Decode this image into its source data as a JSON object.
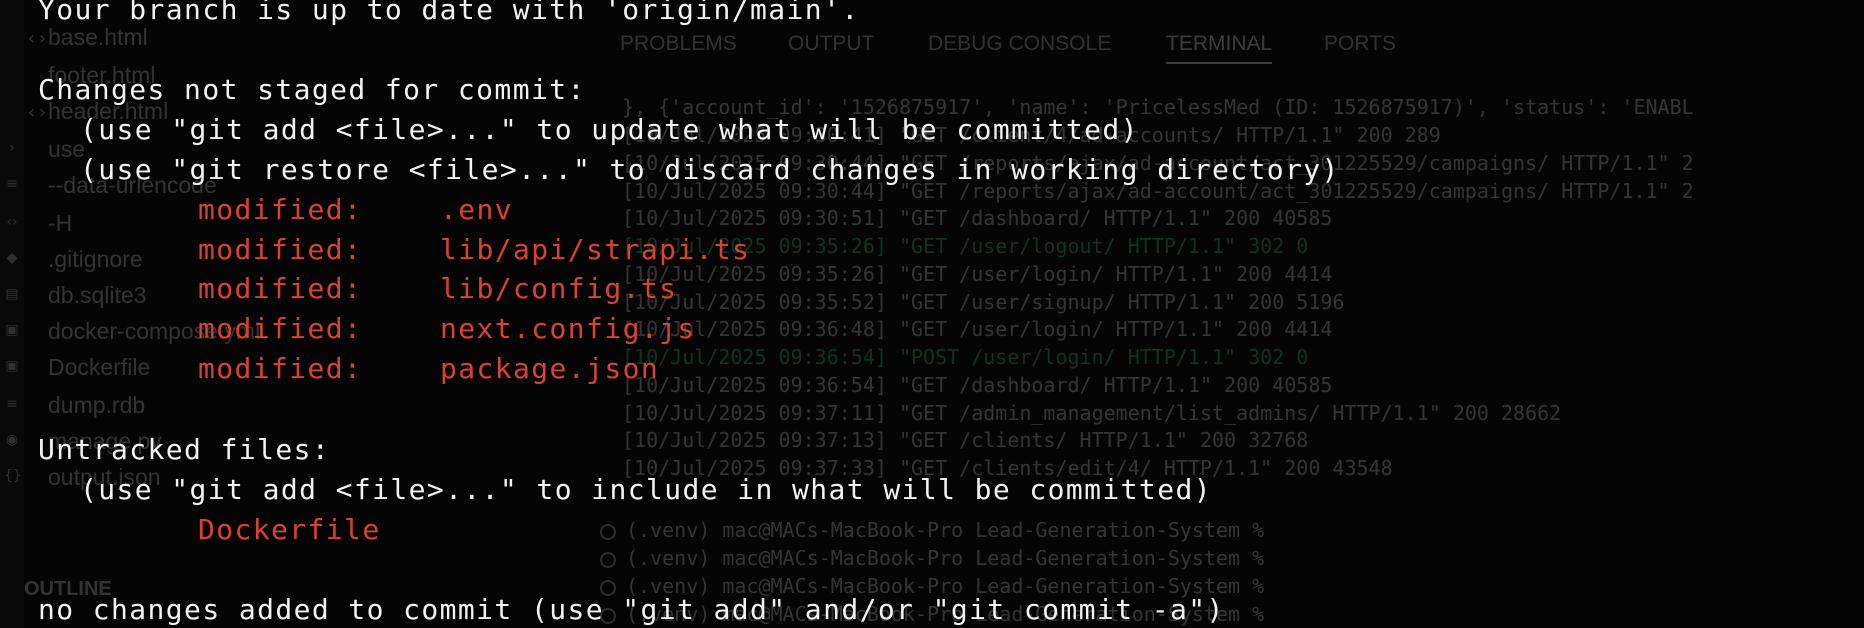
{
  "terminal": {
    "branch_line": "Your branch is up to date with 'origin/main'.",
    "not_staged": {
      "header": "Changes not staged for commit:",
      "hints": [
        "(use \"git add <file>...\" to update what will be committed)",
        "(use \"git restore <file>...\" to discard changes in working directory)"
      ],
      "files": [
        {
          "status": "modified:",
          "path": ".env"
        },
        {
          "status": "modified:",
          "path": "lib/api/strapi.ts"
        },
        {
          "status": "modified:",
          "path": "lib/config.ts"
        },
        {
          "status": "modified:",
          "path": "next.config.js"
        },
        {
          "status": "modified:",
          "path": "package.json"
        }
      ]
    },
    "untracked": {
      "header": "Untracked files:",
      "hint": "(use \"git add <file>...\" to include in what will be committed)",
      "files": [
        "Dockerfile"
      ]
    },
    "footer": "no changes added to commit (use \"git add\" and/or \"git commit -a\")"
  },
  "background": {
    "explorer_items": [
      "base.html",
      "footer.html",
      "header.html",
      "use",
      "--data-urlencode",
      "-H",
      ".gitignore",
      "db.sqlite3",
      "docker-compose.yml",
      "Dockerfile",
      "dump.rdb",
      "manage.py",
      "output.json"
    ],
    "outline_label": "OUTLINE",
    "panel_tabs": [
      "PROBLEMS",
      "OUTPUT",
      "DEBUG CONSOLE",
      "TERMINAL",
      "PORTS"
    ],
    "active_tab": "TERMINAL",
    "log_lines": [
      "}, {'account_id': '1526875917', 'name': 'PricelessMed (ID: 1526875917)', 'status': 'ENABL",
      "[10/Jul/2025 09:30:41] \"GET /client/4/ad-accounts/ HTTP/1.1\" 200 289",
      "[10/Jul/2025 09:30:44] \"GET /reports/ajax/ad-account/act_301225529/campaigns/ HTTP/1.1\" 2",
      "[10/Jul/2025 09:30:44] \"GET /reports/ajax/ad-account/act_301225529/campaigns/ HTTP/1.1\" 2",
      "[10/Jul/2025 09:30:51] \"GET /dashboard/ HTTP/1.1\" 200 40585",
      "[10/Jul/2025 09:35:26] \"GET /user/logout/ HTTP/1.1\" 302 0",
      "[10/Jul/2025 09:35:26] \"GET /user/login/ HTTP/1.1\" 200 4414",
      "[10/Jul/2025 09:35:52] \"GET /user/signup/ HTTP/1.1\" 200 5196",
      "[10/Jul/2025 09:36:48] \"GET /user/login/ HTTP/1.1\" 200 4414",
      "[10/Jul/2025 09:36:54] \"POST /user/login/ HTTP/1.1\" 302 0",
      "[10/Jul/2025 09:36:54] \"GET /dashboard/ HTTP/1.1\" 200 40585",
      "[10/Jul/2025 09:37:11] \"GET /admin_management/list_admins/ HTTP/1.1\" 200 28662",
      "[10/Jul/2025 09:37:13] \"GET /clients/ HTTP/1.1\" 200 32768",
      "[10/Jul/2025 09:37:33] \"GET /clients/edit/4/ HTTP/1.1\" 200 43548"
    ],
    "prompt_lines": [
      "(.venv) mac@MACs-MacBook-Pro Lead-Generation-System %",
      "(.venv) mac@MACs-MacBook-Pro Lead-Generation-System %",
      "(.venv) mac@MACs-MacBook-Pro Lead-Generation-System %",
      "(.venv) mac@MACs-MacBook-Pro Lead-Generation-System %"
    ],
    "colors": {
      "modified": "#d9422f",
      "redirect": "#3fd07a",
      "text": "#f2f2f2"
    }
  }
}
